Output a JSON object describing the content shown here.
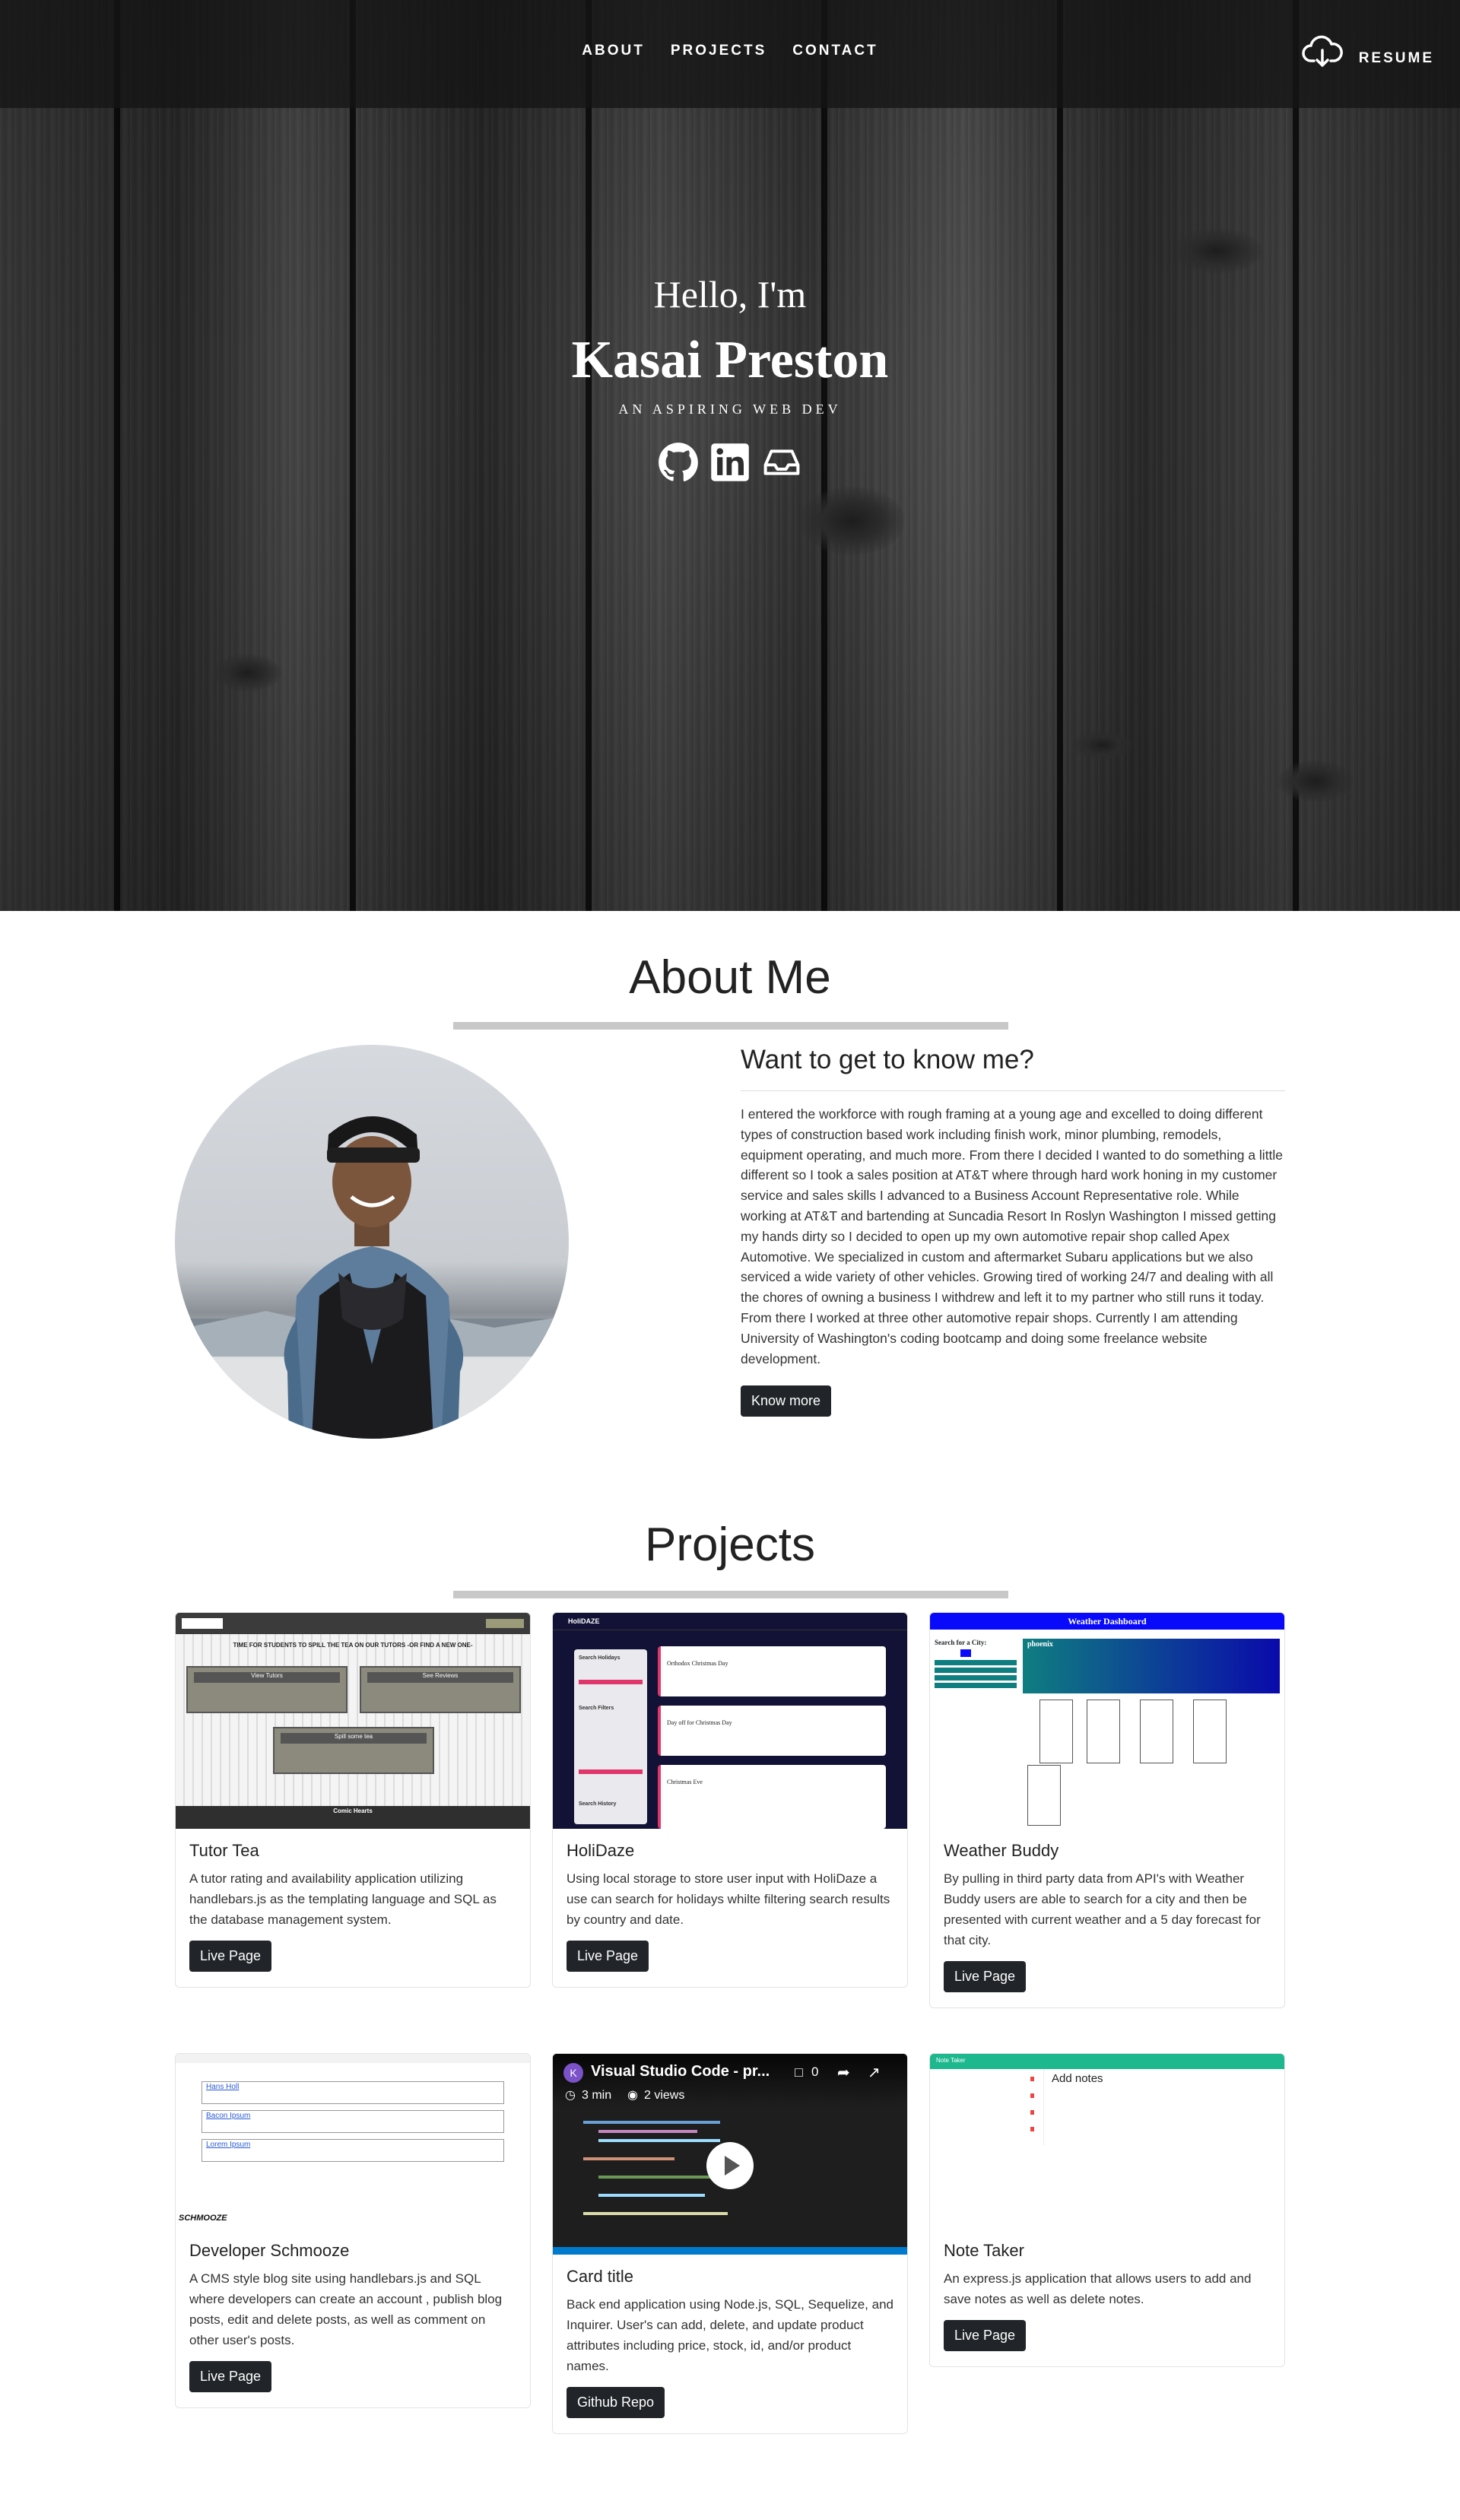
{
  "nav": {
    "links": [
      "ABOUT",
      "PROJECTS",
      "CONTACT"
    ],
    "resume_label": "RESUME"
  },
  "hero": {
    "greeting": "Hello, I'm",
    "name": "Kasai Preston",
    "tagline": "AN ASPIRING WEB DEV",
    "socials": [
      "github-icon",
      "linkedin-icon",
      "inbox-icon"
    ]
  },
  "about": {
    "title": "About Me",
    "heading": "Want to get to know me?",
    "body": "I entered the workforce with rough framing at a young age and excelled to doing different types of construction based work including finish work, minor plumbing, remodels, equipment operating, and much more. From there I decided I wanted to do something a little different so I took a sales position at AT&T where through hard work honing in my customer service and sales skills I advanced to a Business Account Representative role. While working at AT&T and bartending at Suncadia Resort In Roslyn Washington I missed getting my hands dirty so I decided to open up my own automotive repair shop called Apex Automotive. We specialized in custom and aftermarket Subaru applications but we also serviced a wide variety of other vehicles. Growing tired of working 24/7 and dealing with all the chores of owning a business I withdrew and left it to my partner who still runs it today. From there I worked at three other automotive repair shops. Currently I am attending University of Washington's coding bootcamp and doing some freelance website development.",
    "button": "Know more"
  },
  "projects": {
    "title": "Projects",
    "cards": [
      {
        "title": "Tutor Tea",
        "text": "A tutor rating and availability application utilizing handlebars.js as the templating language and SQL as the database management system.",
        "button": "Live Page"
      },
      {
        "title": "HoliDaze",
        "text": "Using local storage to store user input with HoliDaze a use can search for holidays whilte filtering search results by country and date.",
        "button": "Live Page"
      },
      {
        "title": "Weather Buddy",
        "text": "By pulling in third party data from API's with Weather Buddy users are able to search for a city and then be presented with current weather and a 5 day forecast for that city.",
        "button": "Live Page"
      },
      {
        "title": "Developer Schmooze",
        "text": "A CMS style blog site using handlebars.js and SQL where developers can create an account , publish blog posts, edit and delete posts, as well as comment on other user's posts.",
        "button": "Live Page"
      },
      {
        "title": "Card title",
        "text": "Back end application using Node.js, SQL, Sequelize, and Inquirer. User's can add, delete, and update product attributes including price, stock, id, and/or product names.",
        "button": "Github Repo"
      },
      {
        "title": "Note Taker",
        "text": "An express.js application that allows users to add and save notes as well as delete notes.",
        "button": "Live Page"
      }
    ],
    "thumbnails": {
      "tutor_tea": {
        "heading": "TIME FOR STUDENTS TO SPILL THE TEA ON OUR TUTORS -OR FIND A NEW ONE-",
        "panel_a": "View Tutors",
        "panel_b": "See Reviews",
        "panel_c": "Spill some tea",
        "footer": "Comic Hearts"
      },
      "holidaze": {
        "brand": "HoliDAZE",
        "filters": [
          "Search Holidays",
          "Search Filters",
          "Search History"
        ],
        "events": [
          "Orthodox Christmas Day",
          "Day off for Christmas Day",
          "Christmas Eve"
        ]
      },
      "weather": {
        "header": "Weather Dashboard",
        "search_label": "Search for a City:",
        "city": "phoenix"
      },
      "schmooze": {
        "links": [
          "Hans Holl",
          "Bacon Ipsum",
          "Lorem Ipsum"
        ],
        "brand": "SCHMOOZE"
      },
      "video": {
        "title": "Visual Studio Code - pr...",
        "avatar_letter": "K",
        "comments": "0",
        "duration": "3 min",
        "views": "2 views"
      },
      "notes": {
        "header": "Note Taker",
        "placeholder": "Add notes"
      }
    }
  },
  "colors": {
    "nav_bg": "#141414",
    "button_bg": "#212529",
    "rule": "#c8c8c8",
    "weather_header": "#0000ff",
    "weather_teal": "#0f7e80",
    "notes_green": "#1eb88f"
  }
}
